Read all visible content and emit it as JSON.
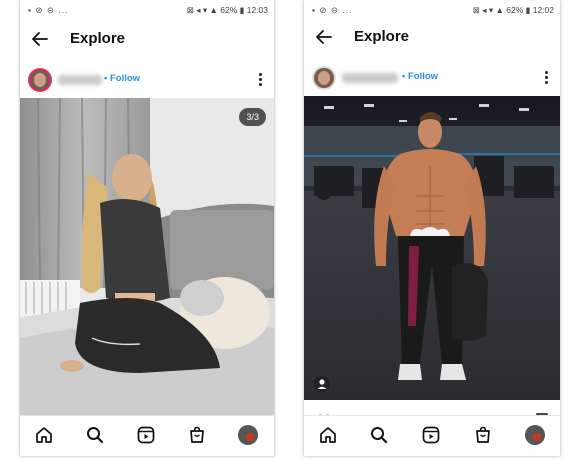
{
  "screens": [
    {
      "status": {
        "left": "▪ ⊘ ⊝ ...",
        "battery": "62%",
        "time": "12:03"
      },
      "header": {
        "title": "Explore"
      },
      "post": {
        "follow_label": "• Follow",
        "counter": "3/3"
      }
    },
    {
      "status": {
        "left": "▪ ⊘ ⊝ ...",
        "battery": "62%",
        "time": "12:02"
      },
      "header": {
        "title": "Explore"
      },
      "post": {
        "follow_label": "• Follow"
      }
    }
  ],
  "nav_icons": [
    "home-icon",
    "search-icon",
    "reels-icon",
    "shop-icon",
    "profile-avatar"
  ],
  "colors": {
    "follow": "#2a8fe4",
    "like": "#ed4956",
    "story_ring": "#e1306c"
  }
}
